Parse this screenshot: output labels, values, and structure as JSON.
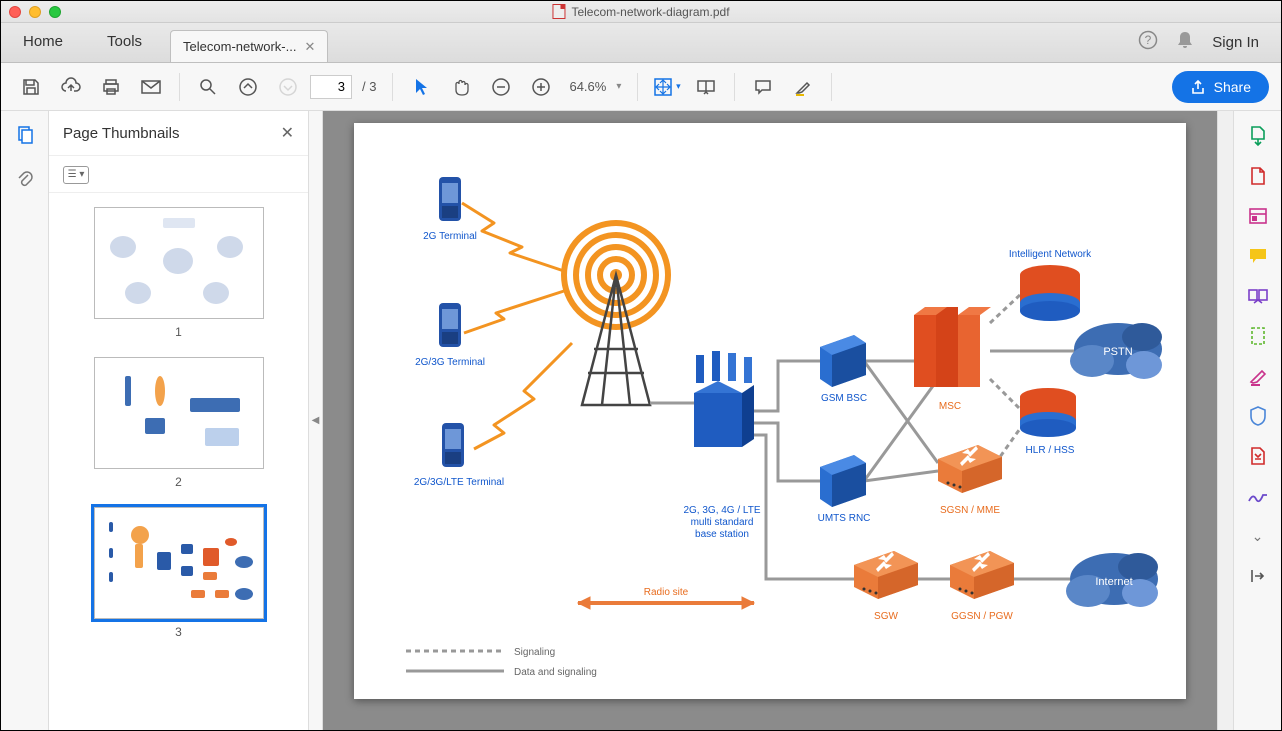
{
  "window_title": "Telecom-network-diagram.pdf",
  "tabs": {
    "home": "Home",
    "tools": "Tools",
    "file_tab": "Telecom-network-..."
  },
  "signin": "Sign In",
  "toolbar": {
    "page_current": "3",
    "page_total": "/ 3",
    "zoom": "64.6%",
    "share": "Share"
  },
  "thumbs": {
    "title": "Page Thumbnails",
    "pages": [
      "1",
      "2",
      "3"
    ],
    "selected": 3
  },
  "diagram": {
    "terminal_2g": "2G Terminal",
    "terminal_2g3g": "2G/3G Terminal",
    "terminal_lte": "2G/3G/LTE Terminal",
    "base_station_l1": "2G, 3G, 4G / LTE",
    "base_station_l2": "multi standard",
    "base_station_l3": "base station",
    "gsm_bsc": "GSM BSC",
    "umts_rnc": "UMTS RNC",
    "msc": "MSC",
    "sgsn": "SGSN / MME",
    "sgw": "SGW",
    "ggsn": "GGSN / PGW",
    "intelligent": "Intelligent Network",
    "hlr": "HLR / HSS",
    "pstn": "PSTN",
    "internet": "Internet",
    "radio_site": "Radio site",
    "legend_sig": "Signaling",
    "legend_data": "Data and signaling"
  }
}
